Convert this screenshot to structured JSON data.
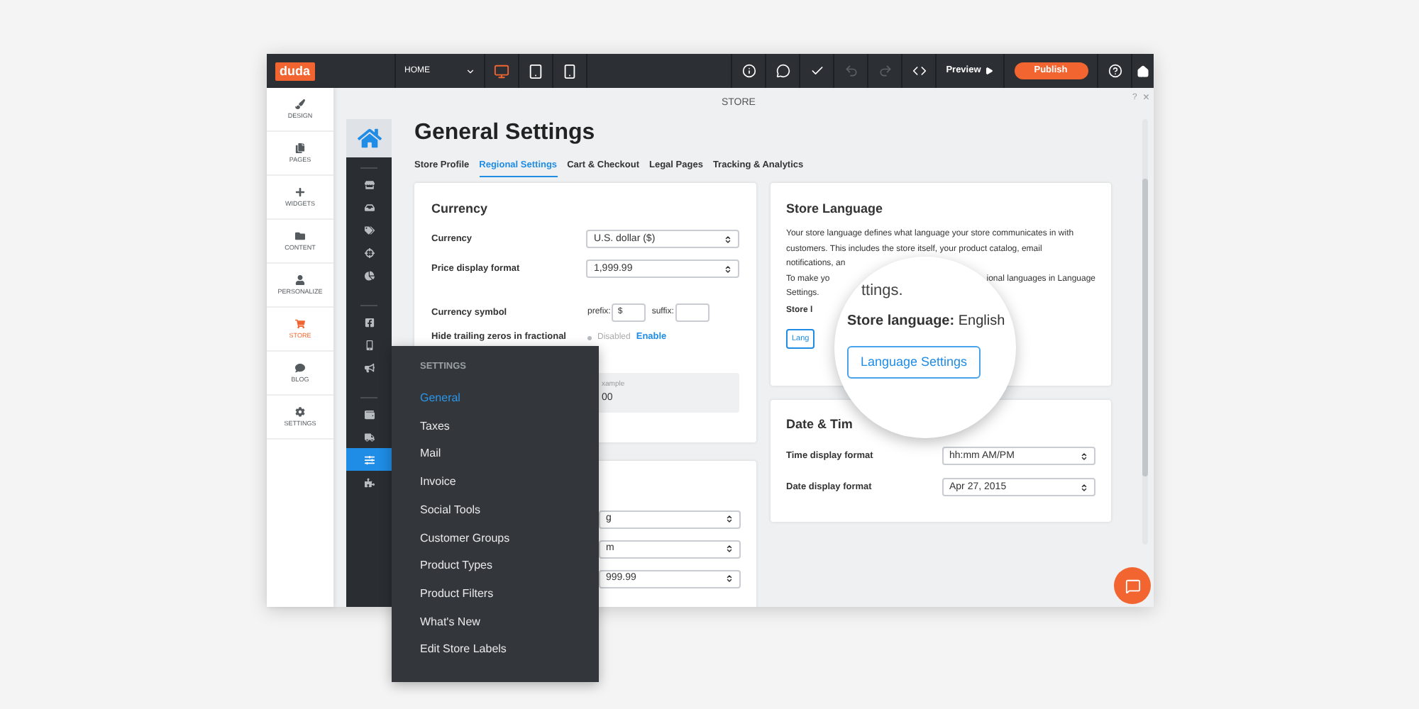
{
  "topbar": {
    "logo": "duda",
    "page_select": "HOME",
    "devices": [
      {
        "kind": "desktop",
        "selected": true
      },
      {
        "kind": "tablet",
        "selected": false
      },
      {
        "kind": "phone",
        "selected": false
      }
    ],
    "tools": [
      {
        "kind": "info",
        "disabled": false
      },
      {
        "kind": "comment",
        "disabled": false
      },
      {
        "kind": "check",
        "disabled": false
      },
      {
        "kind": "undo",
        "disabled": true
      },
      {
        "kind": "redo",
        "disabled": true
      },
      {
        "kind": "code",
        "disabled": false
      }
    ],
    "preview": "Preview",
    "publish": "Publish"
  },
  "sidebar": {
    "items": [
      {
        "kind": "design",
        "label": "DESIGN",
        "selected": false
      },
      {
        "kind": "pages",
        "label": "PAGES",
        "selected": false
      },
      {
        "kind": "widgets",
        "label": "WIDGETS",
        "selected": false
      },
      {
        "kind": "content",
        "label": "CONTENT",
        "selected": false
      },
      {
        "kind": "personalize",
        "label": "PERSONALIZE",
        "selected": false
      },
      {
        "kind": "store",
        "label": "STORE",
        "selected": true
      },
      {
        "kind": "blog",
        "label": "BLOG",
        "selected": false
      },
      {
        "kind": "settings",
        "label": "SETTINGS",
        "selected": false
      }
    ]
  },
  "panel": {
    "title": "STORE",
    "help": "?",
    "close": "×"
  },
  "store_nav": {
    "groups": [
      {
        "items": [
          {
            "kind": "store",
            "selected": false
          },
          {
            "kind": "inbox",
            "selected": false
          },
          {
            "kind": "tags",
            "selected": false
          },
          {
            "kind": "crosshair",
            "selected": false
          },
          {
            "kind": "chart",
            "selected": false
          }
        ]
      },
      {
        "items": [
          {
            "kind": "facebook",
            "selected": false
          },
          {
            "kind": "phone",
            "selected": false
          },
          {
            "kind": "megaphone",
            "selected": false
          }
        ]
      },
      {
        "items": [
          {
            "kind": "wallet",
            "selected": false
          },
          {
            "kind": "truck",
            "selected": false
          },
          {
            "kind": "sliders",
            "selected": true
          },
          {
            "kind": "puzzle",
            "selected": false
          }
        ]
      }
    ]
  },
  "page": {
    "title": "General Settings",
    "tabs": [
      {
        "label": "Store Profile",
        "selected": false
      },
      {
        "label": "Regional Settings",
        "selected": true
      },
      {
        "label": "Cart & Checkout",
        "selected": false
      },
      {
        "label": "Legal Pages",
        "selected": false
      },
      {
        "label": "Tracking & Analytics",
        "selected": false
      }
    ]
  },
  "currency_card": {
    "title": "Currency",
    "rows": [
      {
        "label": "Currency",
        "value": "U.S. dollar ($)"
      },
      {
        "label": "Price display format",
        "value": "1,999.99"
      }
    ],
    "symbol": {
      "label": "Currency symbol",
      "prefix_label": "prefix:",
      "prefix": "$",
      "suffix_label": "suffix:"
    },
    "trailing": {
      "label": "Hide trailing zeros in fractional",
      "enabled": false,
      "status": "Disabled",
      "action": "Enable"
    },
    "example": {
      "label": "xample",
      "value": "00"
    }
  },
  "second_card": {
    "selects": [
      {
        "value": "g"
      },
      {
        "value": "m"
      },
      {
        "value": "999.99"
      }
    ]
  },
  "language_card": {
    "title": "Store Language",
    "lines": [
      "Your store language defines what language your store communicates in with",
      "customers. This includes the store itself, your product catalog, email",
      "notifications, an"
    ],
    "line4_left": "To make yo",
    "line4_right": "ional languages in Language",
    "line5": "Settings.",
    "store_label": "Store l",
    "button": "Lang"
  },
  "magnifier": {
    "fragment": "ttings.",
    "label": "Store language:",
    "value": "English",
    "button": "Language Settings"
  },
  "datetime_card": {
    "title": "Date & Tim",
    "rows": [
      {
        "label": "Time display format",
        "value": "hh:mm AM/PM"
      },
      {
        "label": "Date display format",
        "value": "Apr 27, 2015"
      }
    ]
  },
  "settings_menu": {
    "title": "SETTINGS",
    "items": [
      {
        "label": "General",
        "selected": true
      },
      {
        "label": "Taxes",
        "selected": false
      },
      {
        "label": "Mail",
        "selected": false
      },
      {
        "label": "Invoice",
        "selected": false
      },
      {
        "label": "Social Tools",
        "selected": false
      },
      {
        "label": "Customer Groups",
        "selected": false
      },
      {
        "label": "Product Types",
        "selected": false
      },
      {
        "label": "Product Filters",
        "selected": false
      },
      {
        "label": "What's New",
        "selected": false
      },
      {
        "label": "Edit Store Labels",
        "selected": false
      }
    ]
  }
}
